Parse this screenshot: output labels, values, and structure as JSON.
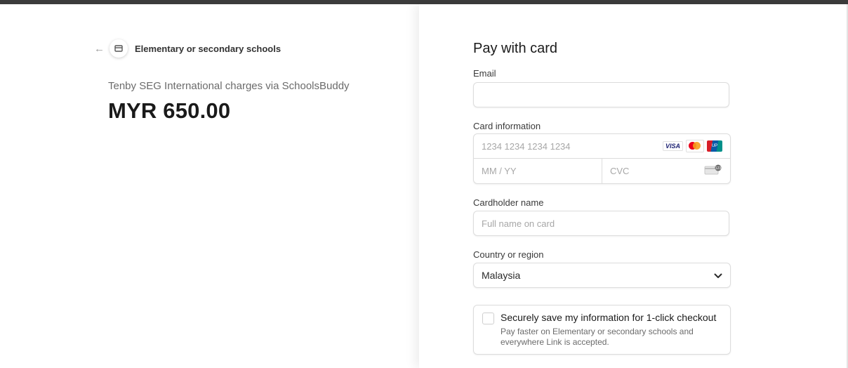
{
  "merchant": {
    "back_icon": "arrow-left-icon",
    "logo_icon": "store-icon",
    "name": "Elementary or secondary schools"
  },
  "summary": {
    "description": "Tenby SEG International charges via SchoolsBuddy",
    "amount": "MYR 650.00"
  },
  "form": {
    "title": "Pay with card",
    "email": {
      "label": "Email",
      "value": "",
      "placeholder": ""
    },
    "card": {
      "label": "Card information",
      "number_placeholder": "1234 1234 1234 1234",
      "expiry_placeholder": "MM / YY",
      "cvc_placeholder": "CVC",
      "brands": [
        "VISA",
        "mastercard",
        "UnionPay"
      ]
    },
    "cardholder": {
      "label": "Cardholder name",
      "placeholder": "Full name on card"
    },
    "country": {
      "label": "Country or region",
      "selected": "Malaysia"
    },
    "save": {
      "title": "Securely save my information for 1-click checkout",
      "description": "Pay faster on Elementary or secondary schools and everywhere Link is accepted.",
      "checked": false
    }
  },
  "colors": {
    "accent": "#1a1f71",
    "border": "#dcdcdc",
    "text": "#1a1a1a"
  }
}
